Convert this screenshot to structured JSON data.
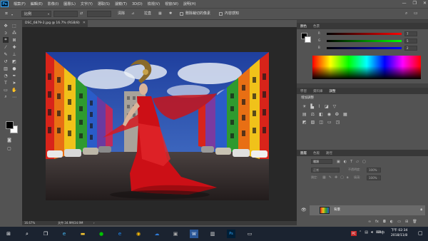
{
  "app": {
    "logo": "Ps",
    "menu": [
      "檔案(F)",
      "編輯(E)",
      "影像(I)",
      "圖層(L)",
      "文字(Y)",
      "選取(S)",
      "濾鏡(T)",
      "3D(D)",
      "檢視(V)",
      "視窗(W)",
      "說明(H)"
    ]
  },
  "window_controls": [
    "—",
    "❐",
    "✕"
  ],
  "options": {
    "ratio_value": "比例",
    "clear_label": "清除",
    "straighten_label": "拉直",
    "delete_cropped_label": "刪除裁切的像素",
    "content_aware_label": "內容感知"
  },
  "document": {
    "tab_title": "DSC_6879-2.jpg @ 16.7% (RGB/8)",
    "zoom": "16.67%",
    "doc_info": "文件:34.9M/34.9M"
  },
  "color_panel": {
    "tabs": [
      "顏色",
      "色票"
    ],
    "r_value": "7",
    "g_value": "5",
    "b_value": "2"
  },
  "adjust_panel": {
    "tabs": [
      "學習",
      "資料庫",
      "調整"
    ],
    "title": "增加調整"
  },
  "layers_panel": {
    "tabs": [
      "圖層",
      "色版",
      "路徑"
    ],
    "kind_label": "種類",
    "blend_mode": "正常",
    "opacity_label": "不透明度:",
    "opacity_value": "100%",
    "lock_label": "鎖定:",
    "fill_label": "填滿:",
    "fill_value": "100%",
    "layer_name": "背景"
  },
  "taskbar": {
    "time": "下午 02:34",
    "date": "2018/11/8",
    "tray_badge": "PC",
    "lang": "中"
  },
  "colors": {
    "ps_blue": "#31a8ff",
    "panel_bg": "#535353",
    "canvas_bg": "#282828",
    "taskbar_bg": "#1b2330"
  }
}
